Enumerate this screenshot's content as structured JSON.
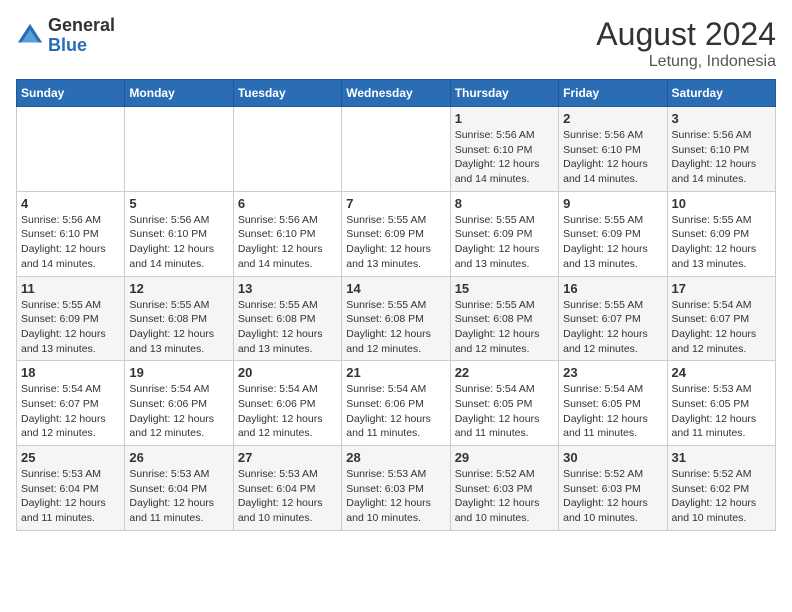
{
  "logo": {
    "general": "General",
    "blue": "Blue"
  },
  "header": {
    "month_year": "August 2024",
    "location": "Letung, Indonesia"
  },
  "weekdays": [
    "Sunday",
    "Monday",
    "Tuesday",
    "Wednesday",
    "Thursday",
    "Friday",
    "Saturday"
  ],
  "weeks": [
    [
      {
        "day": "",
        "info": ""
      },
      {
        "day": "",
        "info": ""
      },
      {
        "day": "",
        "info": ""
      },
      {
        "day": "",
        "info": ""
      },
      {
        "day": "1",
        "info": "Sunrise: 5:56 AM\nSunset: 6:10 PM\nDaylight: 12 hours\nand 14 minutes."
      },
      {
        "day": "2",
        "info": "Sunrise: 5:56 AM\nSunset: 6:10 PM\nDaylight: 12 hours\nand 14 minutes."
      },
      {
        "day": "3",
        "info": "Sunrise: 5:56 AM\nSunset: 6:10 PM\nDaylight: 12 hours\nand 14 minutes."
      }
    ],
    [
      {
        "day": "4",
        "info": "Sunrise: 5:56 AM\nSunset: 6:10 PM\nDaylight: 12 hours\nand 14 minutes."
      },
      {
        "day": "5",
        "info": "Sunrise: 5:56 AM\nSunset: 6:10 PM\nDaylight: 12 hours\nand 14 minutes."
      },
      {
        "day": "6",
        "info": "Sunrise: 5:56 AM\nSunset: 6:10 PM\nDaylight: 12 hours\nand 14 minutes."
      },
      {
        "day": "7",
        "info": "Sunrise: 5:55 AM\nSunset: 6:09 PM\nDaylight: 12 hours\nand 13 minutes."
      },
      {
        "day": "8",
        "info": "Sunrise: 5:55 AM\nSunset: 6:09 PM\nDaylight: 12 hours\nand 13 minutes."
      },
      {
        "day": "9",
        "info": "Sunrise: 5:55 AM\nSunset: 6:09 PM\nDaylight: 12 hours\nand 13 minutes."
      },
      {
        "day": "10",
        "info": "Sunrise: 5:55 AM\nSunset: 6:09 PM\nDaylight: 12 hours\nand 13 minutes."
      }
    ],
    [
      {
        "day": "11",
        "info": "Sunrise: 5:55 AM\nSunset: 6:09 PM\nDaylight: 12 hours\nand 13 minutes."
      },
      {
        "day": "12",
        "info": "Sunrise: 5:55 AM\nSunset: 6:08 PM\nDaylight: 12 hours\nand 13 minutes."
      },
      {
        "day": "13",
        "info": "Sunrise: 5:55 AM\nSunset: 6:08 PM\nDaylight: 12 hours\nand 13 minutes."
      },
      {
        "day": "14",
        "info": "Sunrise: 5:55 AM\nSunset: 6:08 PM\nDaylight: 12 hours\nand 12 minutes."
      },
      {
        "day": "15",
        "info": "Sunrise: 5:55 AM\nSunset: 6:08 PM\nDaylight: 12 hours\nand 12 minutes."
      },
      {
        "day": "16",
        "info": "Sunrise: 5:55 AM\nSunset: 6:07 PM\nDaylight: 12 hours\nand 12 minutes."
      },
      {
        "day": "17",
        "info": "Sunrise: 5:54 AM\nSunset: 6:07 PM\nDaylight: 12 hours\nand 12 minutes."
      }
    ],
    [
      {
        "day": "18",
        "info": "Sunrise: 5:54 AM\nSunset: 6:07 PM\nDaylight: 12 hours\nand 12 minutes."
      },
      {
        "day": "19",
        "info": "Sunrise: 5:54 AM\nSunset: 6:06 PM\nDaylight: 12 hours\nand 12 minutes."
      },
      {
        "day": "20",
        "info": "Sunrise: 5:54 AM\nSunset: 6:06 PM\nDaylight: 12 hours\nand 12 minutes."
      },
      {
        "day": "21",
        "info": "Sunrise: 5:54 AM\nSunset: 6:06 PM\nDaylight: 12 hours\nand 11 minutes."
      },
      {
        "day": "22",
        "info": "Sunrise: 5:54 AM\nSunset: 6:05 PM\nDaylight: 12 hours\nand 11 minutes."
      },
      {
        "day": "23",
        "info": "Sunrise: 5:54 AM\nSunset: 6:05 PM\nDaylight: 12 hours\nand 11 minutes."
      },
      {
        "day": "24",
        "info": "Sunrise: 5:53 AM\nSunset: 6:05 PM\nDaylight: 12 hours\nand 11 minutes."
      }
    ],
    [
      {
        "day": "25",
        "info": "Sunrise: 5:53 AM\nSunset: 6:04 PM\nDaylight: 12 hours\nand 11 minutes."
      },
      {
        "day": "26",
        "info": "Sunrise: 5:53 AM\nSunset: 6:04 PM\nDaylight: 12 hours\nand 11 minutes."
      },
      {
        "day": "27",
        "info": "Sunrise: 5:53 AM\nSunset: 6:04 PM\nDaylight: 12 hours\nand 10 minutes."
      },
      {
        "day": "28",
        "info": "Sunrise: 5:53 AM\nSunset: 6:03 PM\nDaylight: 12 hours\nand 10 minutes."
      },
      {
        "day": "29",
        "info": "Sunrise: 5:52 AM\nSunset: 6:03 PM\nDaylight: 12 hours\nand 10 minutes."
      },
      {
        "day": "30",
        "info": "Sunrise: 5:52 AM\nSunset: 6:03 PM\nDaylight: 12 hours\nand 10 minutes."
      },
      {
        "day": "31",
        "info": "Sunrise: 5:52 AM\nSunset: 6:02 PM\nDaylight: 12 hours\nand 10 minutes."
      }
    ]
  ]
}
